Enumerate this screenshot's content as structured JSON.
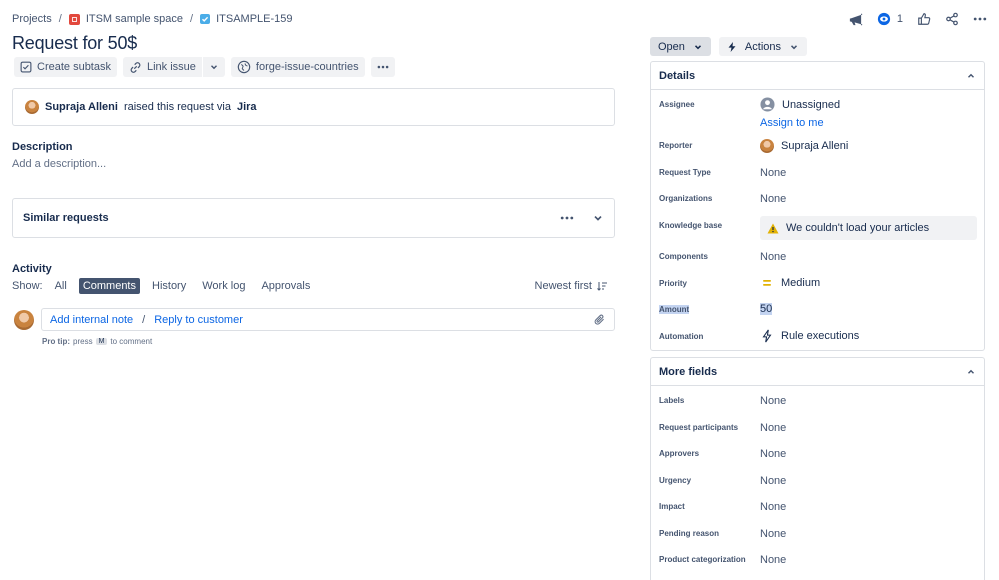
{
  "breadcrumb": {
    "projects": "Projects",
    "space": "ITSM sample space",
    "issue_key": "ITSAMPLE-159"
  },
  "header": {
    "watch_count": "1"
  },
  "issue": {
    "title": "Request for 50$"
  },
  "toolbar": {
    "create_subtask": "Create subtask",
    "link_issue": "Link issue",
    "forge_app": "forge-issue-countries"
  },
  "raised": {
    "user": "Supraja Alleni",
    "text": "raised this request via",
    "channel": "Jira"
  },
  "description": {
    "heading": "Description",
    "placeholder": "Add a description..."
  },
  "similar": {
    "label": "Similar requests"
  },
  "activity": {
    "heading": "Activity",
    "show_label": "Show:",
    "tabs": [
      "All",
      "Comments",
      "History",
      "Work log",
      "Approvals"
    ],
    "active_tab": "Comments",
    "sort_label": "Newest first",
    "add_internal_note": "Add internal note",
    "slash": "/",
    "reply_to_customer": "Reply to customer",
    "protip_prefix": "Pro tip:",
    "protip_press": "press",
    "protip_key": "M",
    "protip_suffix": "to comment"
  },
  "status": {
    "current": "Open",
    "actions": "Actions"
  },
  "details": {
    "heading": "Details",
    "assignee_label": "Assignee",
    "assignee_value": "Unassigned",
    "assign_to_me": "Assign to me",
    "reporter_label": "Reporter",
    "reporter_value": "Supraja Alleni",
    "request_type_label": "Request Type",
    "request_type_value": "None",
    "organizations_label": "Organizations",
    "organizations_value": "None",
    "knowledge_base_label": "Knowledge base",
    "knowledge_base_value": "We couldn't load your articles",
    "components_label": "Components",
    "components_value": "None",
    "priority_label": "Priority",
    "priority_value": "Medium",
    "amount_label": "Amount",
    "amount_value": "50",
    "automation_label": "Automation",
    "automation_value": "Rule executions"
  },
  "more_fields": {
    "heading": "More fields",
    "rows": [
      {
        "label": "Labels",
        "value": "None"
      },
      {
        "label": "Request participants",
        "value": "None"
      },
      {
        "label": "Approvers",
        "value": "None"
      },
      {
        "label": "Urgency",
        "value": "None"
      },
      {
        "label": "Impact",
        "value": "None"
      },
      {
        "label": "Pending reason",
        "value": "None"
      },
      {
        "label": "Product categorization",
        "value": "None"
      }
    ]
  },
  "colors": {
    "link": "#0c66e4",
    "priority_medium": "#e2b203",
    "warning": "#e2b203",
    "active_tab_bg": "#44546f"
  }
}
